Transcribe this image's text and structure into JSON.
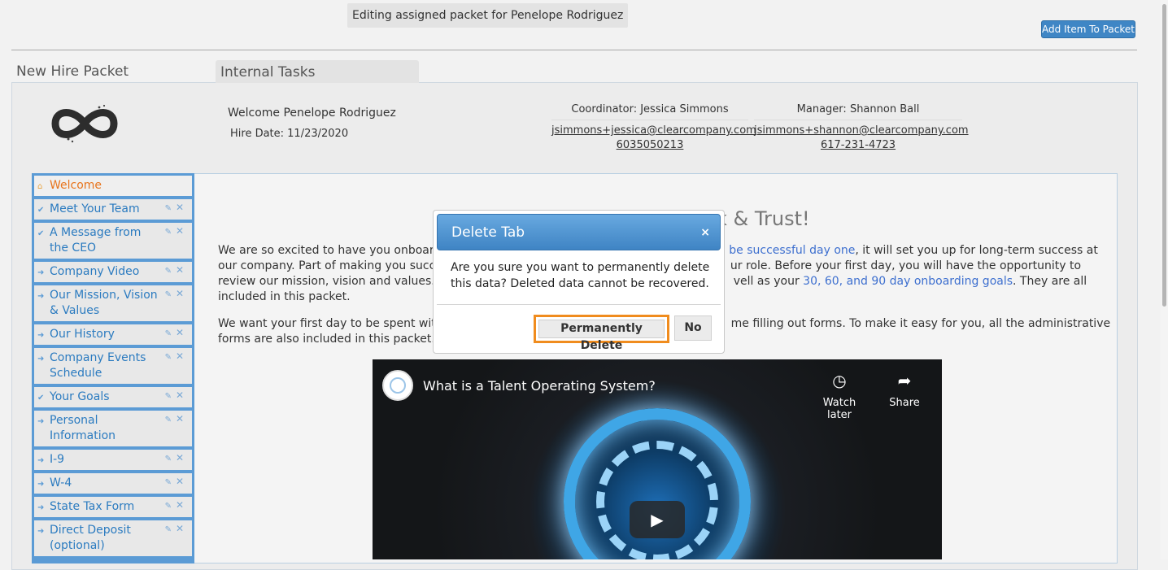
{
  "header": {
    "banner": "Editing assigned packet for Penelope Rodriguez",
    "add_button": "Add Item To Packet"
  },
  "packet": {
    "title": "New Hire Packet",
    "tab_label": "Internal Tasks"
  },
  "employee": {
    "welcome": "Welcome Penelope Rodriguez",
    "hire_date": "Hire Date: 11/23/2020"
  },
  "coordinator": {
    "role": "Coordinator: Jessica Simmons",
    "email": "jsimmons+jessica@clearcompany.com",
    "phone": "6035050213"
  },
  "manager": {
    "role": "Manager: Shannon Ball",
    "email": "jsimmons+shannon@clearcompany.com",
    "phone": "617-231-4723"
  },
  "sidebar": {
    "items": [
      {
        "label": "Welcome",
        "mark": "⌂"
      },
      {
        "label": "Meet Your Team",
        "mark": "✔"
      },
      {
        "label": "A Message from the CEO",
        "mark": "✔"
      },
      {
        "label": "Company Video",
        "mark": "➜"
      },
      {
        "label": "Our Mission, Vision & Values",
        "mark": "➜"
      },
      {
        "label": "Our History",
        "mark": "➜"
      },
      {
        "label": "Company Events Schedule",
        "mark": "➜"
      },
      {
        "label": "Your Goals",
        "mark": "✔"
      },
      {
        "label": "Personal Information",
        "mark": "➜"
      },
      {
        "label": "I-9",
        "mark": "➜"
      },
      {
        "label": "W-4",
        "mark": "➜"
      },
      {
        "label": "State Tax Form",
        "mark": "➜"
      },
      {
        "label": "Direct Deposit (optional)",
        "mark": "➜"
      }
    ]
  },
  "content": {
    "heading_tail": "k & Trust!",
    "p1_line1_start": "We are so excited to have you onboard",
    "p1_link1": "be successful day one",
    "p1_line1_end": ", it will set you up for long-term success at",
    "p1_line2_start": "our company. Part of making you succe",
    "p1_line2_end": "ur role. Before your first day, you will have the opportunity to",
    "p1_line3_start": "review our mission, vision and values. Y",
    "p1_line3_mid": "vell as your ",
    "p1_link2": "30, 60, and 90 day onboarding goals",
    "p1_line3_end": ". They are all",
    "p1_line4": "included in this packet.",
    "p2_line1_start": "We want your first day to be spent with",
    "p2_line1_end": "me filling out forms. To make it easy for you, all the administrative",
    "p2_line2": "forms are also included in this packet."
  },
  "video": {
    "title": "What is a Talent Operating System?",
    "watch_later": "Watch later",
    "share": "Share"
  },
  "modal": {
    "title": "Delete Tab",
    "close": "×",
    "message": "Are you sure you want to permanently delete this data? Deleted data cannot be recovered.",
    "confirm": "Permanently Delete",
    "cancel": "No"
  }
}
